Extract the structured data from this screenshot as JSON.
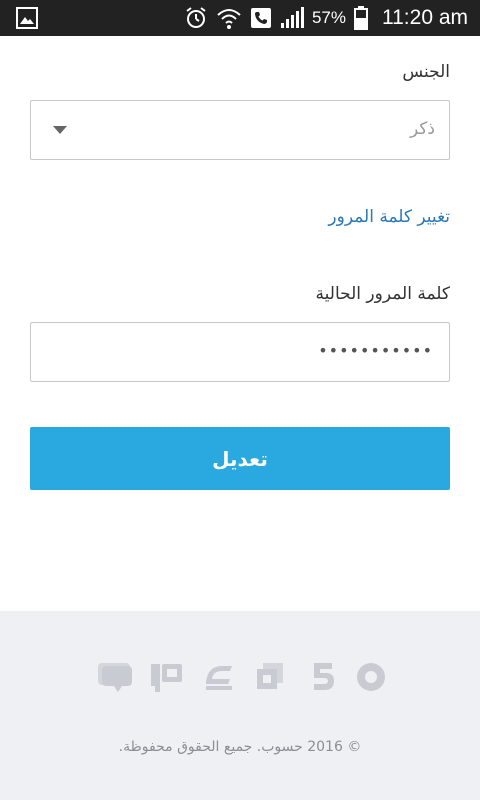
{
  "status_bar": {
    "battery": "57%",
    "time": "11:20 am",
    "icons": [
      "gallery-icon",
      "alarm-icon",
      "wifi-icon",
      "call-icon",
      "signal-icon",
      "battery-icon"
    ]
  },
  "form": {
    "gender_label": "الجنس",
    "gender_value": "ذكر",
    "change_password_link": "تغيير كلمة المرور",
    "current_password_label": "كلمة المرور الحالية",
    "current_password_value": "•••••••••••",
    "submit_label": "تعديل"
  },
  "footer": {
    "brand_icons": [
      "chat-brand-icon",
      "qa-brand-icon",
      "graduation-brand-icon",
      "layers-brand-icon",
      "five-brand-icon",
      "circle-brand-icon"
    ],
    "copyright": "© 2016 حسوب. جميع الحقوق محفوظة."
  },
  "colors": {
    "accent": "#2aa8e0",
    "link": "#2a7ab8",
    "statusbar": "#222222",
    "footer_bg": "#eef0f3"
  }
}
